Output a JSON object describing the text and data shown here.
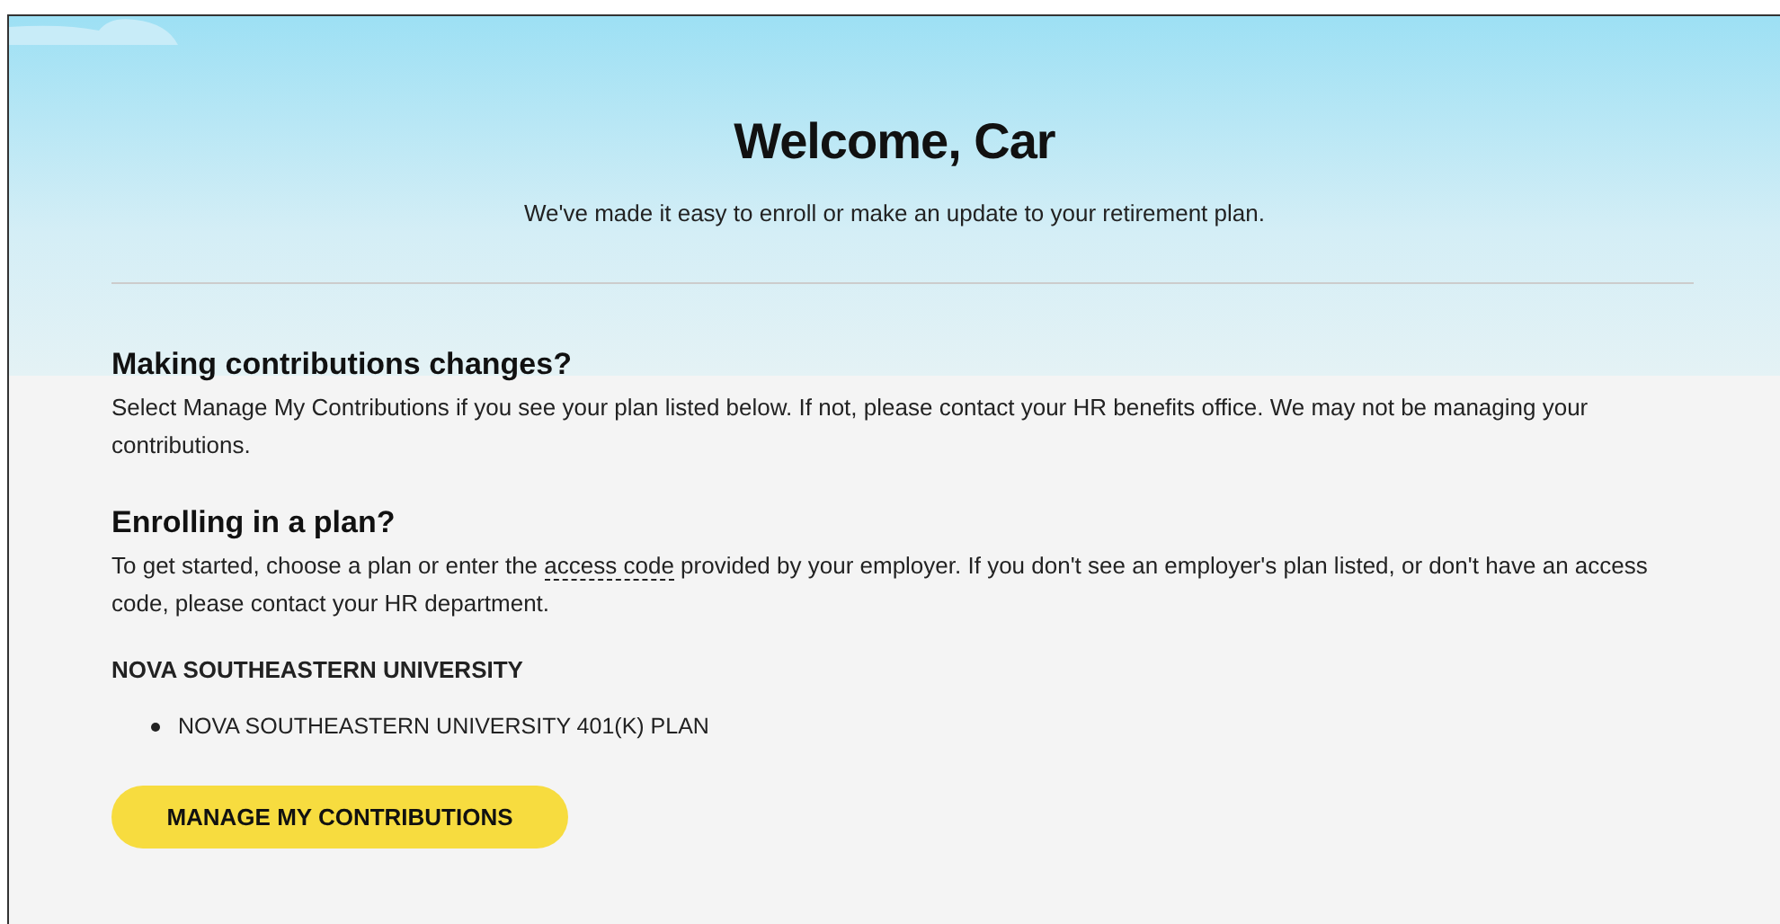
{
  "header": {
    "title": "Welcome, Car",
    "subtitle": "We've made it easy to enroll or make an update to your retirement plan."
  },
  "sections": [
    {
      "heading": "Making contributions changes?",
      "text_before": "Select Manage My Contributions if you see your plan listed below. If not, please contact your HR benefits office. We may not be managing your contributions."
    },
    {
      "heading": "Enrolling in a plan?",
      "text_before": "To get started, choose a plan or enter the ",
      "link": "access code",
      "text_after": " provided by your employer. If you don't see an employer's plan listed, or don't have an access code, please contact your HR department."
    }
  ],
  "employer": {
    "name": "NOVA SOUTHEASTERN UNIVERSITY",
    "plans": [
      "NOVA SOUTHEASTERN UNIVERSITY 401(K) PLAN"
    ]
  },
  "button": "MANAGE MY CONTRIBUTIONS"
}
